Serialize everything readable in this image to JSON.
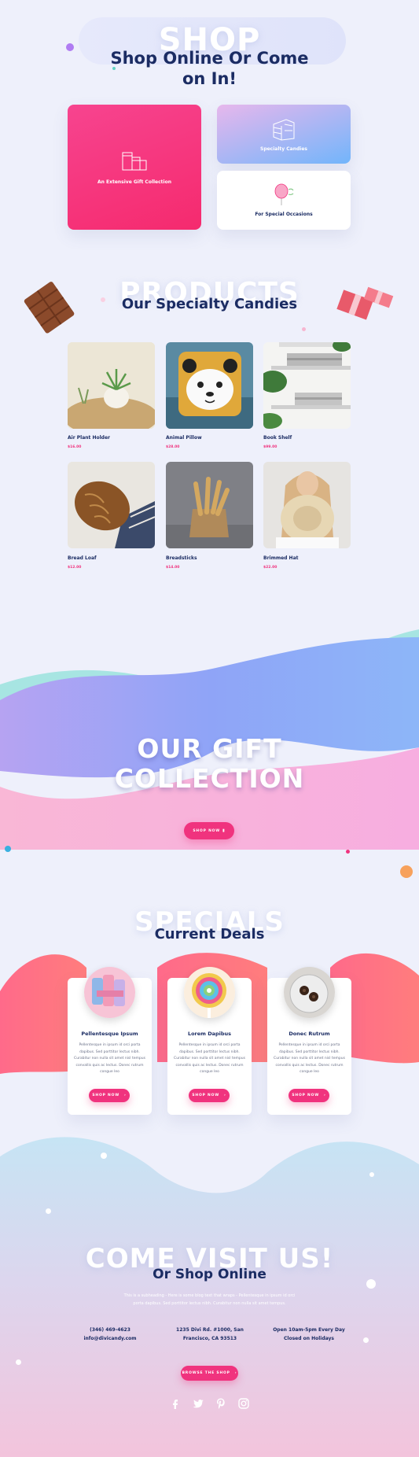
{
  "shop": {
    "ghost": "SHOP",
    "title_line1": "Shop Online Or Come",
    "title_line2": "on In!",
    "cards": [
      {
        "label": "An Extensive Gift Collection"
      },
      {
        "label": "Specialty Candies"
      },
      {
        "label": "For Special Occasions"
      }
    ]
  },
  "products": {
    "ghost": "PRODUCTS",
    "title": "Our Specialty Candies",
    "items": [
      {
        "name": "Air Plant Holder",
        "price": "$16.00"
      },
      {
        "name": "Animal Pillow",
        "price": "$28.00"
      },
      {
        "name": "Book Shelf",
        "price": "$99.00"
      },
      {
        "name": "Bread Loaf",
        "price": "$12.00"
      },
      {
        "name": "Breadsticks",
        "price": "$14.00"
      },
      {
        "name": "Brimmed Hat",
        "price": "$22.00"
      }
    ]
  },
  "gift": {
    "line1": "OUR GIFT",
    "line2": "COLLECTION",
    "button": "SHOP NOW"
  },
  "specials": {
    "ghost": "SPECIALS",
    "title": "Current Deals",
    "deals": [
      {
        "title": "Pellentesque Ipsum",
        "text": "Pellentesque in ipsum id orci porta dapibus. Sed porttitor lectus nibh. Curabitur non nulla sit amet nisl tempus convallis quis ac lectus. Donec rutrum congue leo",
        "button": "SHOP NOW"
      },
      {
        "title": "Lorem Dapibus",
        "text": "Pellentesque in ipsum id orci porta dapibus. Sed porttitor lectus nibh. Curabitur non nulla sit amet nisl tempus convallis quis ac lectus. Donec rutrum congue leo",
        "button": "SHOP NOW"
      },
      {
        "title": "Donec Rutrum",
        "text": "Pellentesque in ipsum id orci porta dapibus. Sed porttitor lectus nibh. Curabitur non nulla sit amet nisl tempus convallis quis ac lectus. Donec rutrum congue leo",
        "button": "SHOP NOW"
      }
    ]
  },
  "visit": {
    "ghost": "COME VISIT US!",
    "title": "Or Shop Online",
    "subtitle_line1": "This is a subheading - Here is some blog text that wraps - Pellentesque in ipsum id orci",
    "subtitle_line2": "porta dapibus. Sed porttitor lectus nibh. Curabitur non nulla sit amet tempus.",
    "phone": "(346) 469-4623",
    "email": "info@divicandy.com",
    "address_line1": "1235 Divi Rd. #1000, San",
    "address_line2": "Francisco, CA 93513",
    "hours_line1": "Open 10am-5pm Every Day",
    "hours_line2": "Closed on Holidays",
    "button": "BROWSE THE SHOP"
  },
  "colors": {
    "accent": "#f0337e",
    "navy": "#1b2c63"
  }
}
